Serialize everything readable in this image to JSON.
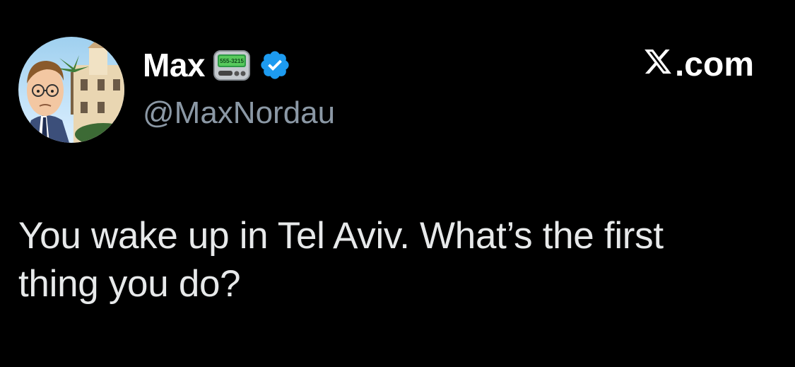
{
  "author": {
    "display_name": "Max",
    "handle": "@MaxNordau",
    "pager_emoji_text": "555-3215",
    "verified_icon": "verified-badge-icon",
    "verified_color": "#1d9bf0"
  },
  "brand": {
    "logo_icon": "x-logo-icon",
    "domain_suffix": ".com"
  },
  "tweet": {
    "text": "You wake up in Tel Aviv. What’s the first thing you do?"
  },
  "colors": {
    "background": "#000000",
    "primary_text": "#e7e9ea",
    "secondary_text": "#8b98a5"
  }
}
